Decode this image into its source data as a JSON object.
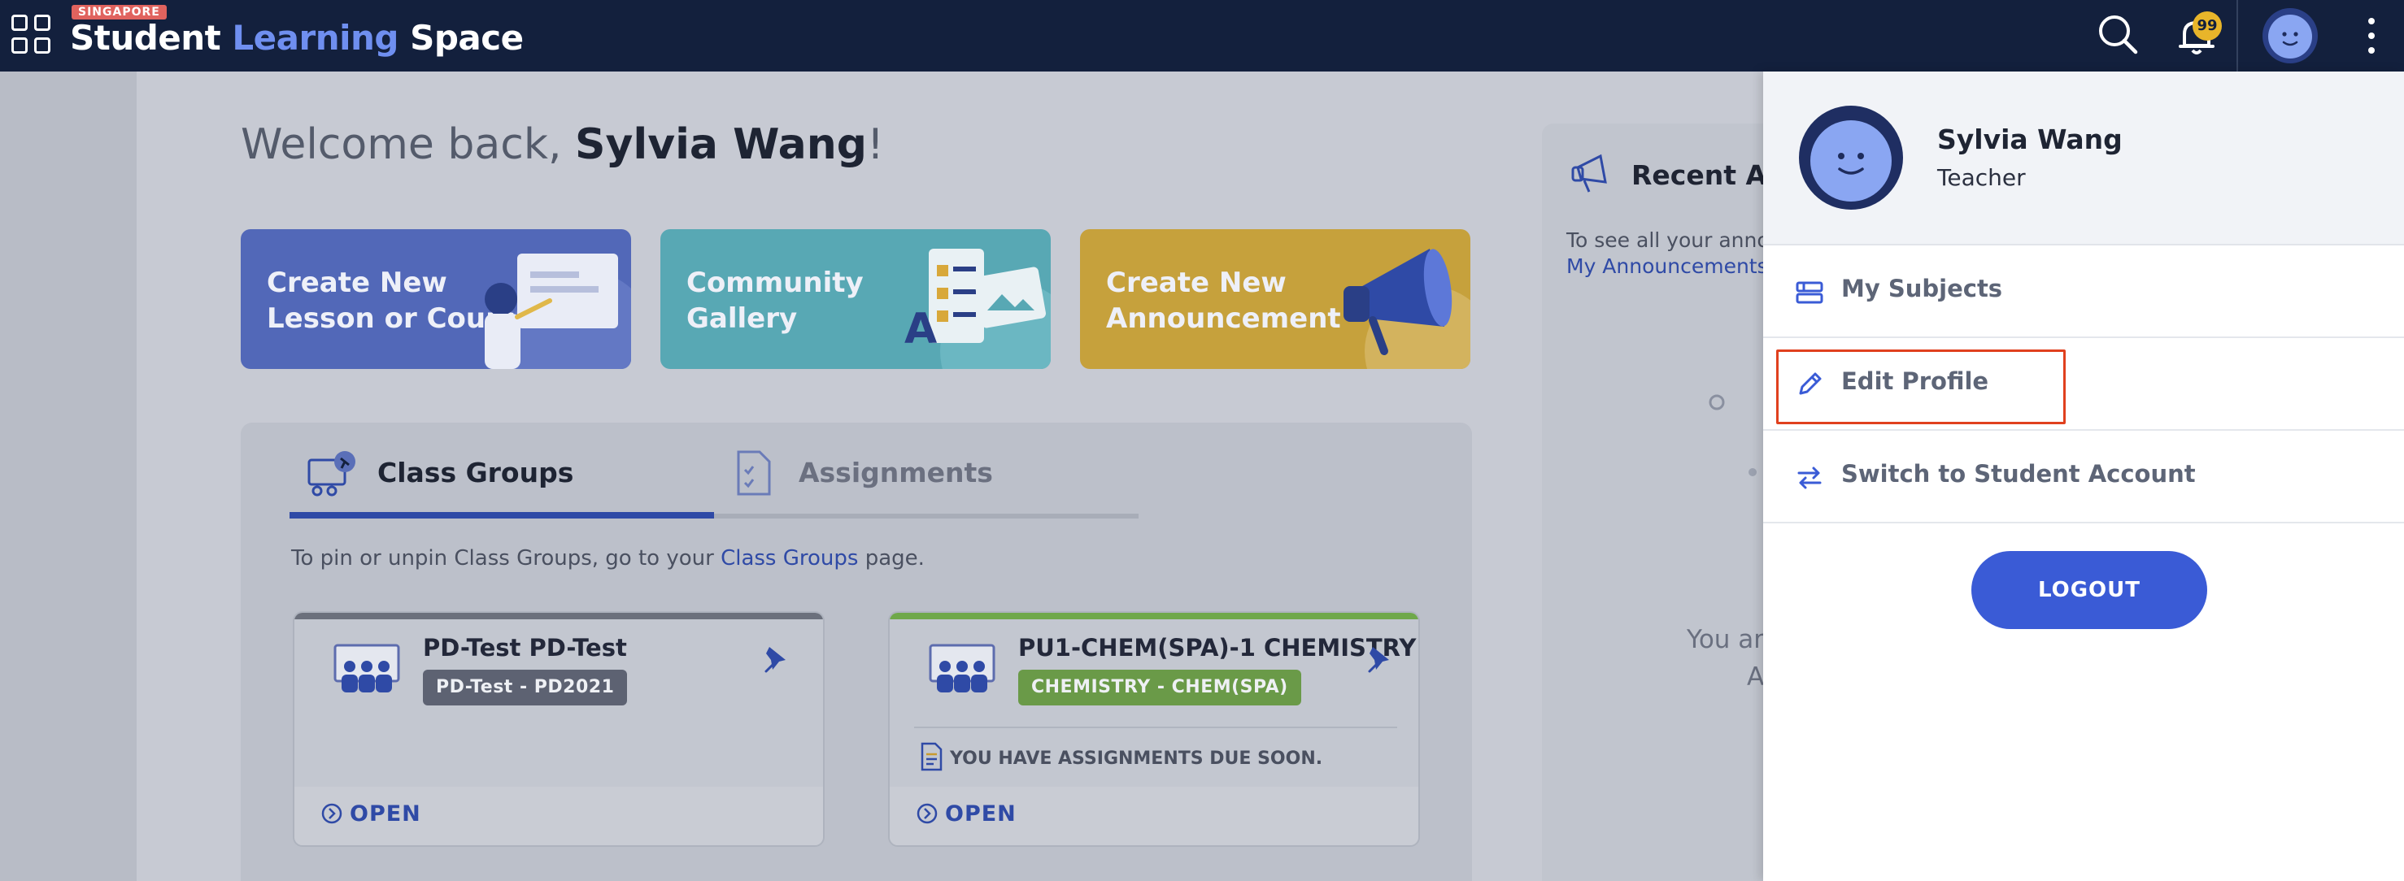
{
  "brand": {
    "badge": "SINGAPORE",
    "word1": "Student",
    "word2": "Learning",
    "word3": "Space"
  },
  "topbar": {
    "notification_count": "99"
  },
  "welcome": {
    "prefix": "Welcome back, ",
    "name": "Sylvia Wang",
    "suffix": "!"
  },
  "cards": [
    {
      "line1": "Create New",
      "line2": "Lesson or Course"
    },
    {
      "line1": "Community",
      "line2": "Gallery"
    },
    {
      "line1": "Create New",
      "line2": "Announcement"
    }
  ],
  "tabs": [
    {
      "label": "Class Groups",
      "active": true
    },
    {
      "label": "Assignments",
      "active": false
    }
  ],
  "pin_hint": {
    "before": "To pin or unpin Class Groups, go to your ",
    "link": "Class Groups",
    "after": " page."
  },
  "class_groups": [
    {
      "title": "PD-Test PD-Test",
      "chip": "PD-Test - PD2021",
      "chip_color": "#5d6272",
      "top_color": "#6b707c",
      "due": "",
      "open": "OPEN"
    },
    {
      "title": "PU1-CHEM(SPA)-1 CHEMISTRY",
      "chip": "CHEMISTRY - CHEM(SPA)",
      "chip_color": "#6a9a48",
      "top_color": "#6fa84a",
      "due": "YOU HAVE ASSIGNMENTS DUE SOON.",
      "open": "OPEN"
    }
  ],
  "announcements": {
    "title": "Recent An",
    "hint_line1": "To see all your anno",
    "hint_link": "My Announcements",
    "empty_line1": "You ar",
    "empty_line2": "A"
  },
  "profile_menu": {
    "name": "Sylvia Wang",
    "role": "Teacher",
    "items": [
      {
        "label": "My Subjects",
        "icon": "subjects-icon"
      },
      {
        "label": "Edit Profile",
        "icon": "pencil-icon",
        "highlighted": true
      },
      {
        "label": "Switch to Student Account",
        "icon": "switch-icon"
      }
    ],
    "logout_label": "LOGOUT"
  },
  "colors": {
    "topbar": "#13203d",
    "accent": "#3a5bd6",
    "highlight_border": "#e0401e"
  }
}
